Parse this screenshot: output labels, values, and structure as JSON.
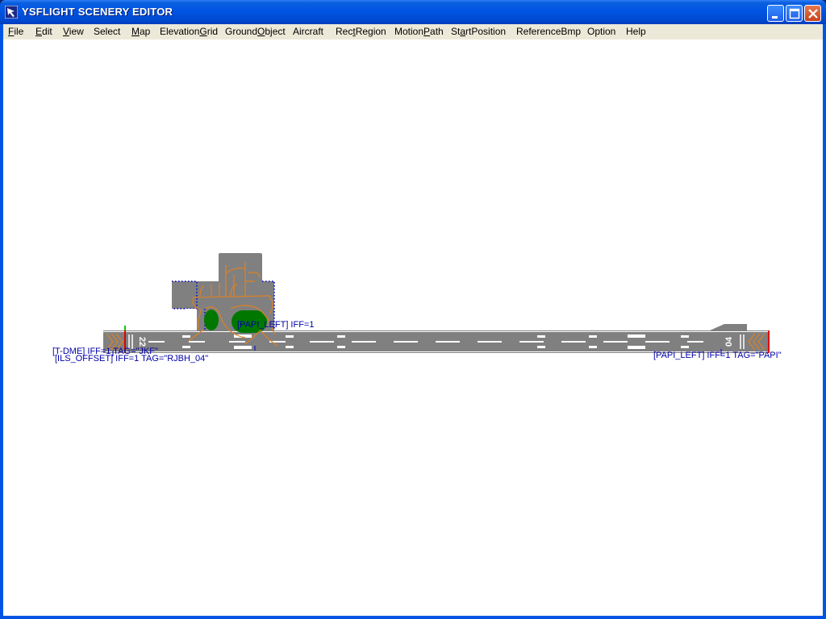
{
  "window": {
    "title": "YSFLIGHT SCENERY EDITOR",
    "icon": "app-arrow-icon"
  },
  "titlebar_buttons": [
    "minimize-icon",
    "maximize-icon",
    "close-icon"
  ],
  "menu": {
    "items": [
      {
        "label": "File",
        "key": "F"
      },
      {
        "label": "Edit",
        "key": "E"
      },
      {
        "label": "View",
        "key": "V"
      },
      {
        "label": "Select",
        "key": ""
      },
      {
        "label": "Map",
        "key": "M"
      },
      {
        "label": "ElevationGrid",
        "key": "G"
      },
      {
        "label": "GroundObject",
        "key": "O"
      },
      {
        "label": "Aircraft",
        "key": ""
      },
      {
        "label": "RectRegion",
        "key": "t"
      },
      {
        "label": "MotionPath",
        "key": "P"
      },
      {
        "label": "StartPosition",
        "key": "a"
      },
      {
        "label": "ReferenceBmp",
        "key": ""
      },
      {
        "label": "Option",
        "key": ""
      },
      {
        "label": "Help",
        "key": ""
      }
    ]
  },
  "scene": {
    "runway_markings": {
      "left_number": "22",
      "right_number": "04"
    },
    "labels": [
      {
        "text": "[PAPI_LEFT] IFF=1"
      },
      {
        "text": "[T-DME] IFF=1 TAG=\"JKF\""
      },
      {
        "text": "[ILS_OFFSET] IFF=1 TAG=\"RJBH_04\""
      },
      {
        "text": "[PAPI_LEFT] IFF=1 TAG=\"PAPI\""
      }
    ],
    "colors": {
      "runway": "#808080",
      "marking": "#ffffff",
      "taxi_line": "#e08020",
      "grass": "#007800",
      "label": "#0000a8"
    }
  }
}
